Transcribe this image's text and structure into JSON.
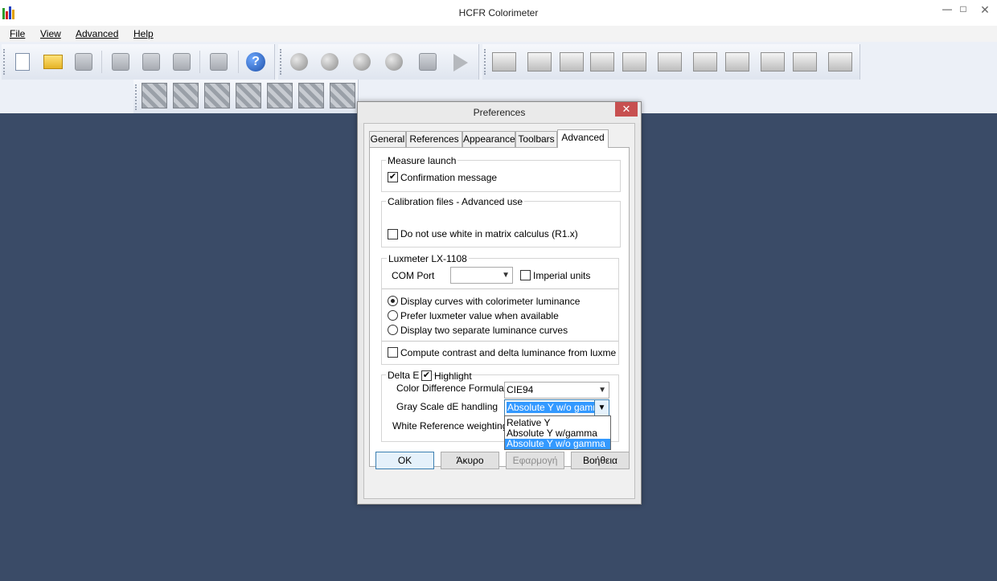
{
  "window": {
    "title": "HCFR Colorimeter",
    "minimize_glyph": "—",
    "maximize_glyph": "□",
    "close_glyph": "✕"
  },
  "menu": [
    {
      "label": "File"
    },
    {
      "label": "View"
    },
    {
      "label": "Advanced"
    },
    {
      "label": "Help"
    }
  ],
  "toolbar": {
    "help_glyph": "?",
    "icons": [
      "new-document-icon",
      "open-folder-icon",
      "save-icon",
      "cut-icon",
      "copy-icon",
      "paste-icon",
      "print-icon",
      "help-icon",
      "measure-spheres-icon",
      "camera-icon",
      "play-icon",
      "graph-view-icon",
      "pattern-icon"
    ]
  },
  "dialog": {
    "title": "Preferences",
    "close_glyph": "✕",
    "tabs": [
      "General",
      "References",
      "Appearance",
      "Toolbars",
      "Advanced"
    ],
    "active_tab": "Advanced",
    "measure_launch": {
      "label": "Measure launch",
      "confirmation_message": "Confirmation message",
      "confirmation_checked": true
    },
    "calibration": {
      "label": "Calibration files - Advanced use",
      "no_white_matrix": "Do not use white in matrix calculus (R1.x)",
      "no_white_checked": false
    },
    "luxmeter": {
      "label": "Luxmeter LX-1108",
      "com_port_label": "COM Port",
      "com_port_value": "",
      "imperial_units": "Imperial units",
      "imperial_checked": false,
      "radios": [
        {
          "label": "Display curves with colorimeter luminance",
          "checked": true
        },
        {
          "label": "Prefer luxmeter value when available",
          "checked": false
        },
        {
          "label": "Display two separate luminance curves",
          "checked": false
        }
      ],
      "compute_contrast": "Compute contrast and delta luminance from luxmeter val",
      "compute_checked": false
    },
    "delta_e": {
      "label": "Delta E",
      "highlight": "Highlight",
      "highlight_checked": true,
      "formula_label": "Color Difference Formula",
      "formula_value": "CIE94",
      "gray_label": "Gray Scale dE handling",
      "gray_value": "Absolute Y w/o gamma",
      "white_ref_label": "White Reference weighting",
      "gray_options": [
        "Relative Y",
        "Absolute Y w/gamma",
        "Absolute Y w/o gamma"
      ],
      "gray_selected_index": 2
    },
    "buttons": {
      "ok": "OK",
      "cancel": "Άκυρο",
      "apply": "Εφαρμογή",
      "help": "Βοήθεια"
    }
  },
  "colors": {
    "workspace": "#3a4b67",
    "selection": "#3399ff",
    "close_red": "#c75050"
  }
}
